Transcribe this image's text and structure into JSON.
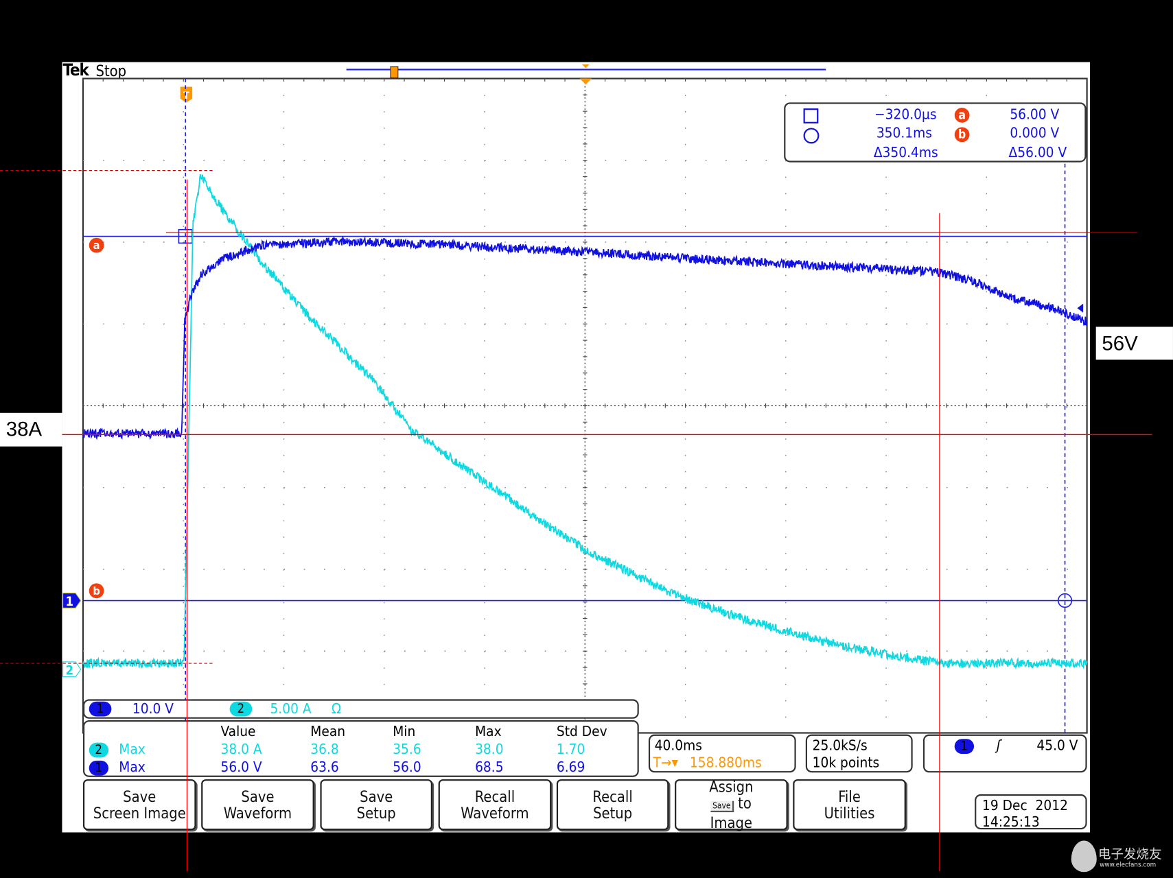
{
  "header": {
    "brand": "Tek",
    "status": "Stop"
  },
  "cursor_readout": {
    "time_a": "−320.0µs",
    "time_b": "350.1ms",
    "time_delta": "Δ350.4ms",
    "a_label": "a",
    "b_label": "b",
    "volt_a": "56.00 V",
    "volt_b": "0.000 V",
    "volt_delta": "Δ56.00 V"
  },
  "channels": {
    "ch1": {
      "num": "1",
      "scale": "10.0 V",
      "color": "#1010e0"
    },
    "ch2": {
      "num": "2",
      "scale": "5.00 A",
      "suffix": "Ω",
      "color": "#10d8e0"
    }
  },
  "measurements": {
    "headers": [
      "Value",
      "Mean",
      "Min",
      "Max",
      "Std Dev"
    ],
    "rows": [
      {
        "ch": "2",
        "type": "Max",
        "values": [
          "38.0 A",
          "36.8",
          "35.6",
          "38.0",
          "1.70"
        ]
      },
      {
        "ch": "1",
        "type": "Max",
        "values": [
          "56.0 V",
          "63.6",
          "56.0",
          "68.5",
          "6.69"
        ]
      }
    ]
  },
  "timebase": {
    "scale": "40.0ms",
    "position": "158.880ms"
  },
  "acquisition": {
    "rate": "25.0kS/s",
    "length": "10k points"
  },
  "trigger": {
    "source": "1",
    "slope": "rising",
    "slope_glyph": "ʃ",
    "level": "45.0 V"
  },
  "buttons": [
    {
      "l1": "Save",
      "l2": "Screen Image"
    },
    {
      "l1": "Save",
      "l2": "Waveform"
    },
    {
      "l1": "Save",
      "l2": "Setup"
    },
    {
      "l1": "Recall",
      "l2": "Waveform"
    },
    {
      "l1": "Recall",
      "l2": "Setup"
    },
    {
      "l1": "Assign",
      "l2": "Save",
      "l3": "to",
      "l4": "Image"
    },
    {
      "l1": "File",
      "l2": "Utilities"
    }
  ],
  "datetime": {
    "date": "19 Dec  2012",
    "time": "14:25:13"
  },
  "annotations": {
    "current_label": "38A",
    "voltage_label": "56V"
  },
  "watermark": {
    "name": "电子发烧友",
    "url": "www.elecfans.com"
  },
  "chart_data": {
    "type": "line",
    "x_unit": "ms",
    "time_per_div": 40,
    "x_range": [
      -41,
      359
    ],
    "grid": true,
    "series": [
      {
        "channel": "1",
        "unit": "V",
        "volts_per_div": 10,
        "color": "#1010e0",
        "x": [
          -41.1,
          -1.8,
          -0.6,
          1.8,
          6.3,
          15.2,
          30.1,
          59.9,
          104.6,
          158.9,
          223.8,
          298.4,
          313.3,
          328.2,
          343.1,
          358.9
        ],
        "y": [
          20.4,
          20.4,
          34.1,
          37.3,
          40.0,
          41.9,
          43.4,
          43.9,
          43.5,
          42.6,
          41.4,
          40.2,
          39.1,
          37.0,
          35.9,
          34.1
        ]
      },
      {
        "channel": "2",
        "unit": "A",
        "amps_per_div": 5,
        "color": "#10d8e0",
        "x": [
          -41.1,
          -0.9,
          0.9,
          2.7,
          5.7,
          15.2,
          30.1,
          45.0,
          59.9,
          74.8,
          89.7,
          104.6,
          134.4,
          158.9,
          194.0,
          223.8,
          253.7,
          283.5,
          301.3,
          358.9
        ],
        "y": [
          0.37,
          0.37,
          13.5,
          27.2,
          30.2,
          27.9,
          24.9,
          22.2,
          19.9,
          17.6,
          14.6,
          13.0,
          9.8,
          7.3,
          4.6,
          3.0,
          1.7,
          0.78,
          0.37,
          0.37
        ]
      }
    ],
    "cursors": {
      "a_time_ms": -0.32,
      "b_time_ms": 350.1,
      "a_volt": 56.0,
      "b_volt": 0.0
    }
  }
}
